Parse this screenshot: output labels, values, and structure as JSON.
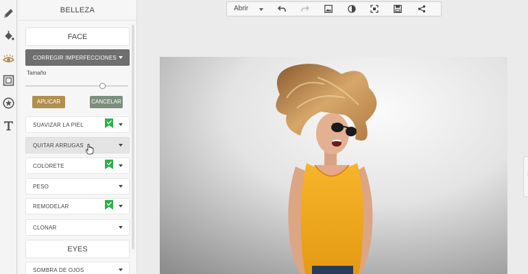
{
  "panel": {
    "title": "BELLEZA",
    "face_header": "FACE",
    "eyes_header": "EYES",
    "active_tool": "CORREGIR IMPERFECCIONES",
    "size_label": "Tamaño",
    "size_value": 0.75,
    "apply_label": "APLICAR",
    "cancel_label": "CANCELAR",
    "items": [
      {
        "label": "SUAVIZAR LA PIEL",
        "badge": true
      },
      {
        "label": "QUITAR ARRUGAS",
        "badge": false
      },
      {
        "label": "COLORETE",
        "badge": true
      },
      {
        "label": "PESO",
        "badge": false
      },
      {
        "label": "REMODELAR",
        "badge": true
      },
      {
        "label": "CLONAR",
        "badge": false
      }
    ],
    "eyes_items": [
      {
        "label": "SOMBRA DE OJOS"
      }
    ]
  },
  "toolbar": {
    "open_label": "Abrir",
    "icons": [
      "undo-icon",
      "redo-icon",
      "image-icon",
      "compare-icon",
      "fit-screen-icon",
      "save-icon",
      "share-icon"
    ]
  },
  "rail": {
    "icons": [
      "pencil-icon",
      "paint-bucket-icon",
      "eye-icon",
      "frame-icon",
      "star-icon",
      "text-icon"
    ]
  },
  "colors": {
    "accent_gold": "#b18f4f",
    "cancel_green": "#7c8f7d",
    "badge_green": "#2eaf4a",
    "active_row": "#6f6f6f"
  }
}
